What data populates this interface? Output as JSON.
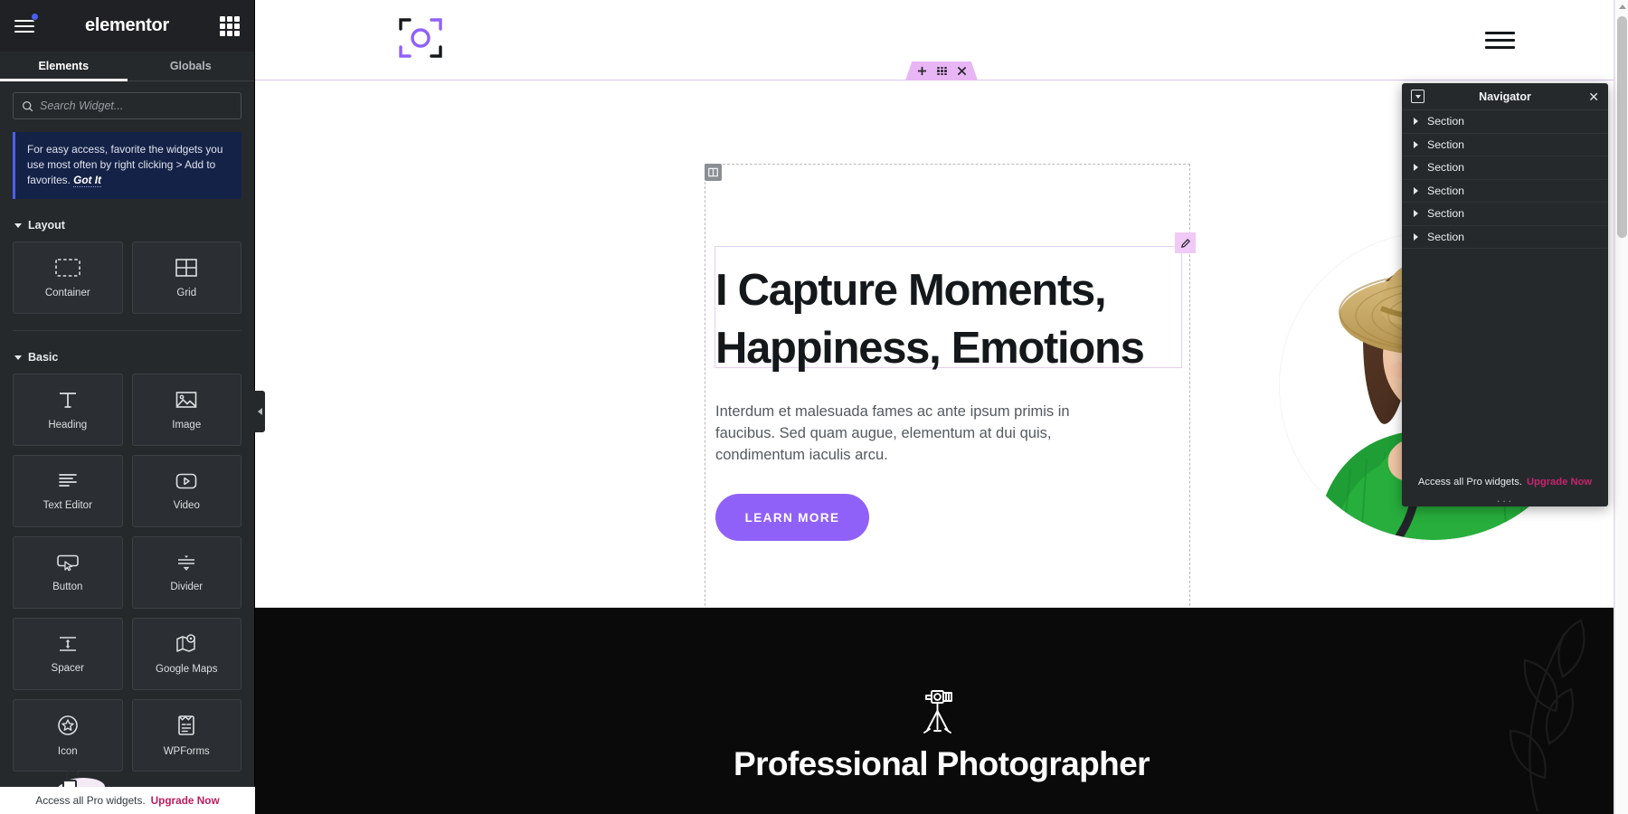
{
  "panel": {
    "brand": "elementor",
    "menu_icon": "hamburger-menu-icon",
    "apps_icon": "apps-grid-icon",
    "tabs": [
      {
        "label": "Elements",
        "active": true
      },
      {
        "label": "Globals",
        "active": false
      }
    ],
    "search": {
      "placeholder": "Search Widget...",
      "value": "",
      "icon": "search-icon"
    },
    "notice": {
      "text": "For easy access, favorite the widgets you use most often by right clicking > Add to favorites.",
      "link": "Got It"
    },
    "categories": [
      {
        "title": "Layout",
        "widgets": [
          {
            "label": "Container",
            "icon": "container-icon"
          },
          {
            "label": "Grid",
            "icon": "grid-icon"
          }
        ]
      },
      {
        "title": "Basic",
        "widgets": [
          {
            "label": "Heading",
            "icon": "heading-icon"
          },
          {
            "label": "Image",
            "icon": "image-icon"
          },
          {
            "label": "Text Editor",
            "icon": "text-editor-icon"
          },
          {
            "label": "Video",
            "icon": "video-icon"
          },
          {
            "label": "Button",
            "icon": "button-icon"
          },
          {
            "label": "Divider",
            "icon": "divider-icon"
          },
          {
            "label": "Spacer",
            "icon": "spacer-icon"
          },
          {
            "label": "Google Maps",
            "icon": "google-maps-icon"
          },
          {
            "label": "Icon",
            "icon": "star-icon"
          },
          {
            "label": "WPForms",
            "icon": "wpforms-icon"
          }
        ]
      }
    ],
    "promo": {
      "text": "Access all Pro widgets.",
      "link": "Upgrade Now"
    },
    "collapse_icon": "chevron-left-icon"
  },
  "canvas": {
    "site_header": {
      "logo_icon": "camera-focus-logo",
      "menu_icon": "hamburger-menu-icon"
    },
    "section_toolbar": {
      "add_icon": "plus-icon",
      "drag_icon": "drag-dots-icon",
      "delete_icon": "close-icon"
    },
    "column_handle_icon": "column-icon",
    "edit_badge_icon": "pencil-edit-icon",
    "hero": {
      "heading": "I Capture Moments, Happiness, Emotions",
      "paragraph": "Interdum et malesuada fames ac ante ipsum primis in faucibus. Sed quam augue, elementum at dui quis, condimentum iaculis arcu.",
      "button": "LEARN MORE",
      "button_color": "#9061F9",
      "image_alt": "smiling-woman-in-straw-hat-holding-dslr-camera"
    },
    "dark_section": {
      "icon": "tripod-camera-icon",
      "title": "Professional Photographer",
      "background": "#0a0a0a",
      "decor_icon": "leaf-branch-icon"
    }
  },
  "navigator": {
    "title": "Navigator",
    "dock_icon": "dock-toggle-icon",
    "close_icon": "close-icon",
    "items": [
      {
        "label": "Section"
      },
      {
        "label": "Section"
      },
      {
        "label": "Section"
      },
      {
        "label": "Section"
      },
      {
        "label": "Section"
      },
      {
        "label": "Section"
      }
    ],
    "promo": {
      "text": "Access all Pro widgets.",
      "link": "Upgrade Now"
    },
    "grip": "···"
  }
}
